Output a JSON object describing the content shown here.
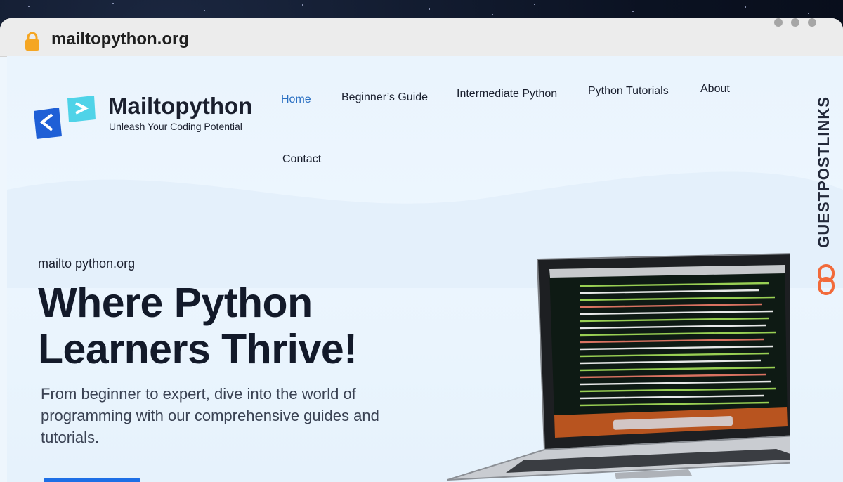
{
  "browser": {
    "url": "mailtopython.org"
  },
  "site": {
    "brand_name": "Mailtopython",
    "tagline": "Unleash Your Coding Potential"
  },
  "nav": {
    "items": [
      {
        "label": "Home",
        "active": true
      },
      {
        "label": "Beginner’s Guide"
      },
      {
        "label": "Intermediate Python"
      },
      {
        "label": "Python Tutorials"
      },
      {
        "label": "About"
      },
      {
        "label": "Contact"
      }
    ]
  },
  "hero": {
    "eyebrow": "mailto python.org",
    "headline_line1": "Where Python",
    "headline_line2": "Learners Thrive!",
    "description": "From beginner to expert, dive into the world of programming with our comprehensive guides and tutorials."
  },
  "overlay": {
    "watermark": "GUESTPOSTLINKS"
  },
  "colors": {
    "accent": "#2a6fc2",
    "cta": "#1d6fe6",
    "logo_dark": "#1f5fd6",
    "logo_light": "#4fd3e8",
    "watermark_icon": "#f26a3a"
  },
  "icons": [
    "lock-icon",
    "window-dot",
    "logo-icon",
    "laptop-image",
    "link-icon"
  ]
}
